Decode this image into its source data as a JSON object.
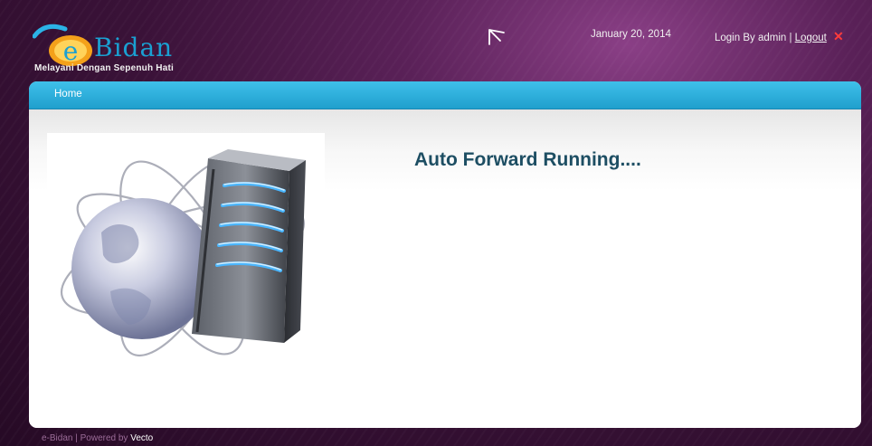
{
  "header": {
    "logo_name": "Bidan",
    "logo_letter": "e",
    "tagline": "Melayani Dengan Sepenuh Hati",
    "date": "January 20, 2014",
    "login_text": "Login By admin |",
    "logout_label": "Logout",
    "close_glyph": "✕"
  },
  "nav": {
    "home_label": "Home"
  },
  "main": {
    "heading": "Auto Forward Running...."
  },
  "footer": {
    "prefix": "e-Bidan | Powered by",
    "vendor": "Vecto"
  },
  "colors": {
    "accent": "#1fa3d3",
    "heading": "#1d4e63",
    "background": "#3a1238",
    "close": "#ff3b3b"
  }
}
